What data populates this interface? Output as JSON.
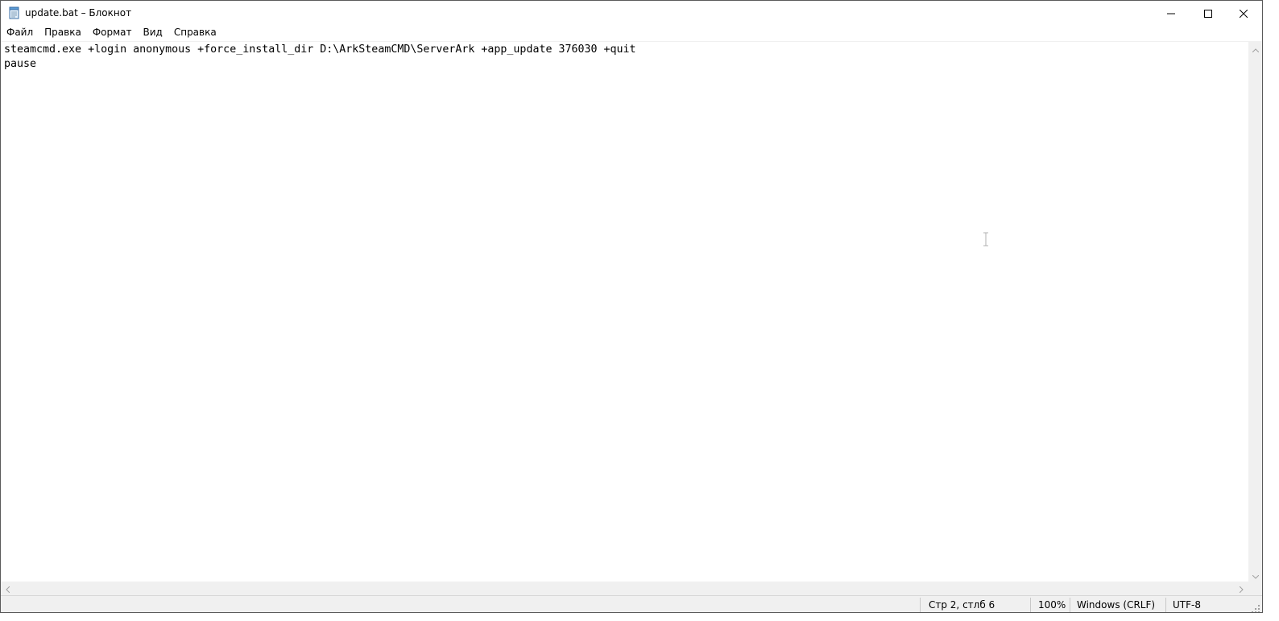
{
  "window": {
    "title": "update.bat – Блокнот"
  },
  "menu": {
    "items": [
      "Файл",
      "Правка",
      "Формат",
      "Вид",
      "Справка"
    ]
  },
  "editor": {
    "lines": [
      "steamcmd.exe +login anonymous +force_install_dir D:\\ArkSteamCMD\\ServerArk +app_update 376030 +quit",
      "pause"
    ]
  },
  "status": {
    "position": "Стр 2, стлб 6",
    "zoom": "100%",
    "line_endings": "Windows (CRLF)",
    "encoding": "UTF-8"
  },
  "icons": {
    "app": "notepad-icon",
    "minimize": "minimize-icon",
    "maximize": "maximize-icon",
    "close": "close-icon"
  }
}
